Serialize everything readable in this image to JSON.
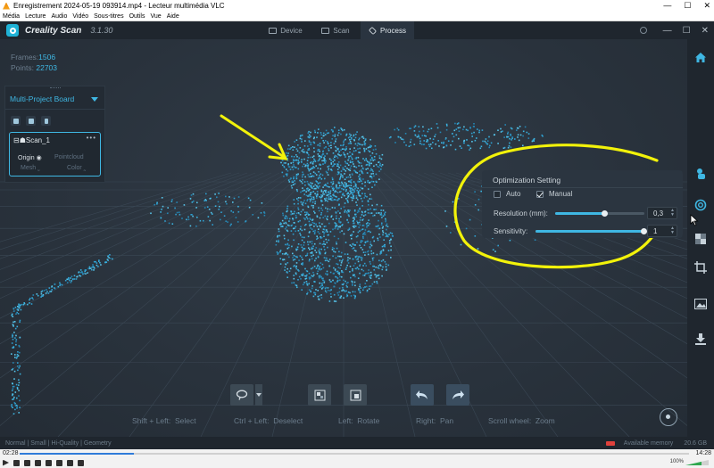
{
  "vlc": {
    "title": "Enregistrement 2024-05-19 093914.mp4 - Lecteur multimédia VLC",
    "menu": [
      "Média",
      "Lecture",
      "Audio",
      "Vidéo",
      "Sous-titres",
      "Outils",
      "Vue",
      "Aide"
    ],
    "time_elapsed": "02:28",
    "time_total": "14:28",
    "progress": 0.17,
    "volume_pct": "100%"
  },
  "app": {
    "name": "Creality Scan",
    "version": "3.1.30",
    "tabs": [
      {
        "label": "Device",
        "icon": "device-icon",
        "active": false
      },
      {
        "label": "Scan",
        "icon": "scan-icon",
        "active": false
      },
      {
        "label": "Process",
        "icon": "layers-icon",
        "active": true
      }
    ],
    "window_controls": [
      "—",
      "☐",
      "✕"
    ]
  },
  "stats": {
    "frames_label": "Frames:",
    "frames_value": "1506",
    "points_label": "Points:",
    "points_value": "22703"
  },
  "board": {
    "title": "Multi-Project Board",
    "scan": {
      "name": "Scan_1",
      "origin": "Origin",
      "pointcloud": "Pointcloud",
      "mesh": "Mesh",
      "color": "Color"
    }
  },
  "optimization": {
    "title": "Optimization Setting",
    "auto_label": "Auto",
    "auto_checked": false,
    "manual_label": "Manual",
    "manual_checked": true,
    "resolution_label": "Resolution (mm):",
    "resolution_value": "0,3",
    "resolution_level": 0.55,
    "sensitivity_label": "Sensitivity:",
    "sensitivity_value": "1",
    "sensitivity_level": 1.0
  },
  "hints": {
    "shift_left": "Shift + Left:",
    "select": "Select",
    "ctrl_left": "Ctrl + Left:",
    "deselect": "Deselect",
    "left": "Left:",
    "rotate": "Rotate",
    "right": "Right:",
    "pan": "Pan",
    "scroll": "Scroll wheel:",
    "zoom": "Zoom"
  },
  "status": {
    "quality": "Normal | Small | Hi-Quality | Geometry",
    "memory_label": "Available memory",
    "memory_value": "20.6 GB"
  },
  "colors": {
    "accent": "#3fb7e3",
    "annotation": "#f2f20a",
    "point_cloud": "#2f9fd0",
    "background": "#2b3440"
  }
}
